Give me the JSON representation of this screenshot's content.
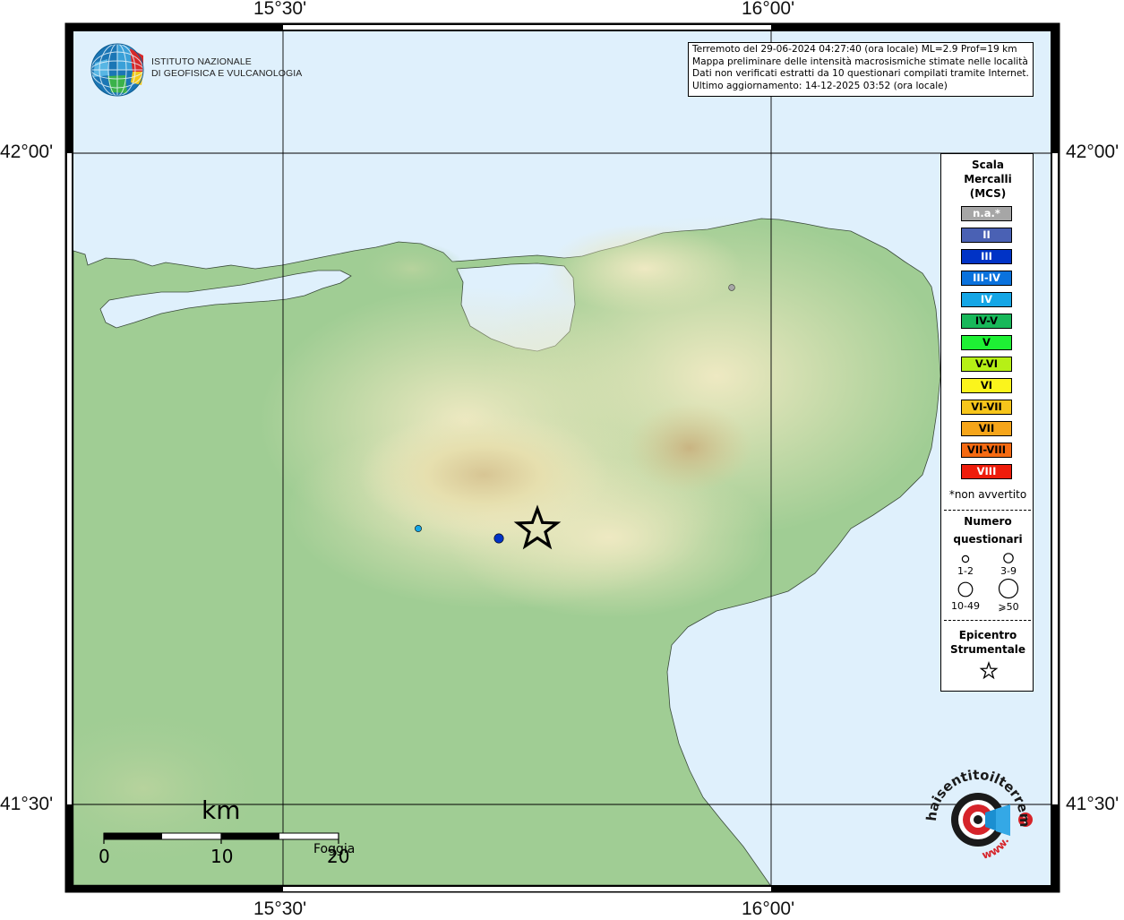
{
  "coords": {
    "lon_left": "15°30'",
    "lon_right": "16°00'",
    "lat_top": "42°00'",
    "lat_bottom": "41°30'"
  },
  "logo": {
    "line1": "ISTITUTO NAZIONALE",
    "line2": "DI GEOFISICA E VULCANOLOGIA"
  },
  "info": {
    "line1": "Terremoto del 29-06-2024 04:27:40 (ora locale) ML=2.9 Prof=19 km",
    "line2": "Mappa preliminare delle intensità macrosismiche stimate nelle località",
    "line3": "Dati non verificati estratti da 10 questionari compilati tramite Internet.",
    "line4": "Ultimo aggiornamento: 14-12-2025 03:52 (ora locale)"
  },
  "legend": {
    "title": [
      "Scala",
      "Mercalli",
      "(MCS)"
    ],
    "intensities": [
      {
        "label": "n.a.*",
        "color": "#a6a6a6",
        "text": "#ffffff"
      },
      {
        "label": "II",
        "color": "#4a61b4",
        "text": "#ffffff"
      },
      {
        "label": "III",
        "color": "#0033c6",
        "text": "#ffffff"
      },
      {
        "label": "III-IV",
        "color": "#0a72dd",
        "text": "#ffffff"
      },
      {
        "label": "IV",
        "color": "#15a6e6",
        "text": "#ffffff"
      },
      {
        "label": "IV-V",
        "color": "#18b85a",
        "text": "#000000"
      },
      {
        "label": "V",
        "color": "#1ef034",
        "text": "#000000"
      },
      {
        "label": "V-VI",
        "color": "#b6f016",
        "text": "#000000"
      },
      {
        "label": "VI",
        "color": "#fbf41c",
        "text": "#000000"
      },
      {
        "label": "VI-VII",
        "color": "#f7c51b",
        "text": "#000000"
      },
      {
        "label": "VII",
        "color": "#f6a51a",
        "text": "#000000"
      },
      {
        "label": "VII-VIII",
        "color": "#f56a12",
        "text": "#000000"
      },
      {
        "label": "VIII",
        "color": "#ee1c0b",
        "text": "#ffffff"
      }
    ],
    "not_felt_note": "*non avvertito",
    "count_title": [
      "Numero",
      "questionari"
    ],
    "count_classes": [
      "1-2",
      "3-9",
      "10-49",
      "⩾50"
    ],
    "epicenter_title": [
      "Epicentro",
      "Strumentale"
    ]
  },
  "scale_bar": {
    "unit": "km",
    "ticks": [
      "0",
      "10",
      "20"
    ]
  },
  "place_label": "Foggia",
  "observations": [
    {
      "intensity": "IV",
      "color": "#15a6e6",
      "count_class": "1-2"
    },
    {
      "intensity": "III",
      "color": "#0033c6",
      "count_class": "3-9"
    },
    {
      "intensity": "n.a.*",
      "color": "#a6a6a6",
      "count_class": "1-2"
    }
  ],
  "badge": {
    "top_text": "haisentitoilterremoto.it",
    "bottom_text": "www."
  },
  "colors": {
    "sea": "#dff0fc",
    "lowland": "#9ccc94",
    "hills": "#e8e6bc",
    "peaks": "#cfbf8c",
    "grid": "#000000"
  }
}
